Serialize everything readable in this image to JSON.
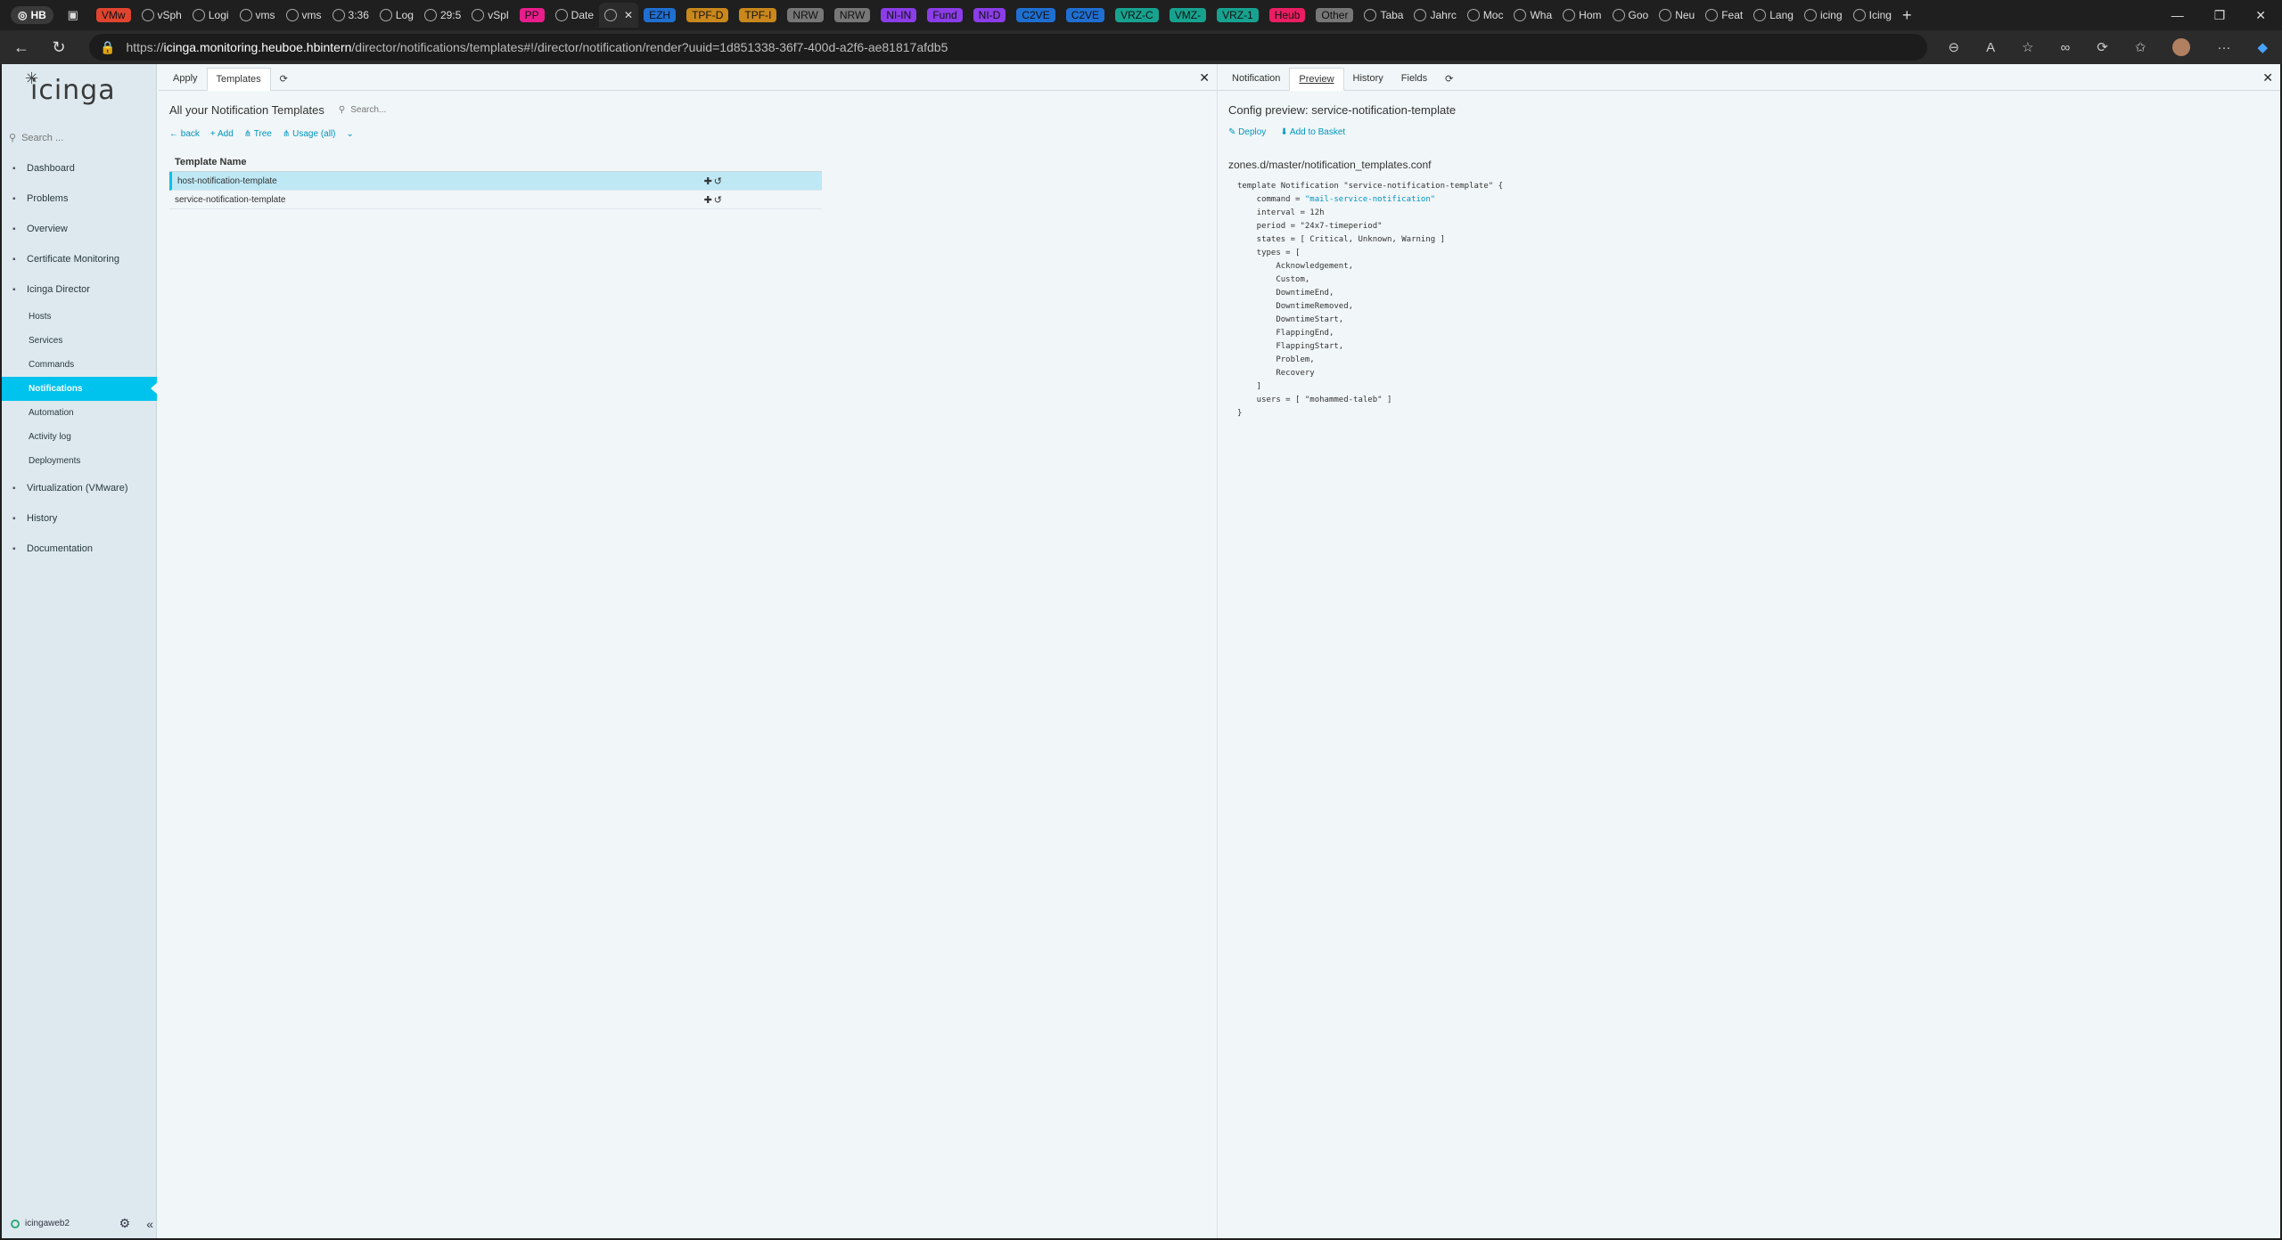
{
  "browser": {
    "profile": "HB",
    "tabs": [
      {
        "label": "VMw",
        "color": "#e0442f"
      },
      {
        "label": "vSph",
        "color": ""
      },
      {
        "label": "Logi",
        "color": ""
      },
      {
        "label": "vms",
        "color": ""
      },
      {
        "label": "vms",
        "color": ""
      },
      {
        "label": "3:36",
        "color": ""
      },
      {
        "label": "Log",
        "color": ""
      },
      {
        "label": "29:5",
        "color": ""
      },
      {
        "label": "vSpl",
        "color": ""
      },
      {
        "label": "PP",
        "color": "#e91e8c"
      },
      {
        "label": "Date",
        "color": ""
      },
      {
        "label": "",
        "color": ""
      },
      {
        "label": "EZH",
        "color": "#1f6fd1"
      },
      {
        "label": "TPF-D",
        "color": "#c9871c"
      },
      {
        "label": "TPF-I",
        "color": "#c9871c"
      },
      {
        "label": "NRW",
        "color": "#777777"
      },
      {
        "label": "NRW",
        "color": "#777777"
      },
      {
        "label": "NI-IN",
        "color": "#8a3de8"
      },
      {
        "label": "Fund",
        "color": "#8a3de8"
      },
      {
        "label": "NI-D",
        "color": "#8a3de8"
      },
      {
        "label": "C2VE",
        "color": "#1f6fd1"
      },
      {
        "label": "C2VE",
        "color": "#1f6fd1"
      },
      {
        "label": "VRZ-C",
        "color": "#17a28f"
      },
      {
        "label": "VMZ-",
        "color": "#17a28f"
      },
      {
        "label": "VRZ-1",
        "color": "#17a28f"
      },
      {
        "label": "Heub",
        "color": "#e91e63"
      },
      {
        "label": "Other",
        "color": "#777777"
      },
      {
        "label": "Taba",
        "color": ""
      },
      {
        "label": "Jahrc",
        "color": ""
      },
      {
        "label": "Moc",
        "color": ""
      },
      {
        "label": "Wha",
        "color": ""
      },
      {
        "label": "Hom",
        "color": ""
      },
      {
        "label": "Goo",
        "color": ""
      },
      {
        "label": "Neu",
        "color": ""
      },
      {
        "label": "Feat",
        "color": ""
      },
      {
        "label": "Lang",
        "color": ""
      },
      {
        "label": "icing",
        "color": ""
      },
      {
        "label": "Icing",
        "color": ""
      }
    ],
    "url_prefix": "https://",
    "url_host": "icinga.monitoring.heuboe.hbintern",
    "url_path": "/director/notifications/templates#!/director/notification/render?uuid=1d851338-36f7-400d-a2f6-ae81817afdb5"
  },
  "sidebar": {
    "logo": "icinga",
    "search_placeholder": "Search ...",
    "items": [
      {
        "label": "Dashboard",
        "icon": "dashboard-icon"
      },
      {
        "label": "Problems",
        "icon": "problems-icon"
      },
      {
        "label": "Overview",
        "icon": "overview-icon"
      },
      {
        "label": "Certificate Monitoring",
        "icon": "certificate-icon"
      },
      {
        "label": "Icinga Director",
        "icon": "director-icon"
      }
    ],
    "director_sub": [
      "Hosts",
      "Services",
      "Commands",
      "Notifications",
      "Automation",
      "Activity log",
      "Deployments"
    ],
    "items_after": [
      {
        "label": "Virtualization (VMware)",
        "icon": "vmware-icon"
      },
      {
        "label": "History",
        "icon": "history-icon"
      },
      {
        "label": "Documentation",
        "icon": "documentation-icon"
      }
    ],
    "user": "icingaweb2"
  },
  "left": {
    "tabs": [
      "Apply",
      "Templates"
    ],
    "title": "All your Notification Templates",
    "search_placeholder": "Search...",
    "actions": [
      "back",
      "Add",
      "Tree",
      "Usage (all)"
    ],
    "column_header": "Template Name",
    "rows": [
      "host-notification-template",
      "service-notification-template"
    ]
  },
  "right": {
    "tabs": [
      "Notification",
      "Preview",
      "History",
      "Fields"
    ],
    "title": "Config preview: service-notification-template",
    "actions": [
      "Deploy",
      "Add to Basket"
    ],
    "filename": "zones.d/master/notification_templates.conf",
    "config": {
      "line1": "template Notification \"service-notification-template\" {",
      "command_key": "    command = ",
      "command_val": "\"mail-service-notification\"",
      "rest": "    interval = 12h\n    period = \"24x7-timeperiod\"\n    states = [ Critical, Unknown, Warning ]\n    types = [\n        Acknowledgement,\n        Custom,\n        DowntimeEnd,\n        DowntimeRemoved,\n        DowntimeStart,\n        FlappingEnd,\n        FlappingStart,\n        Problem,\n        Recovery\n    ]\n    users = [ \"mohammed-taleb\" ]\n}"
    }
  }
}
